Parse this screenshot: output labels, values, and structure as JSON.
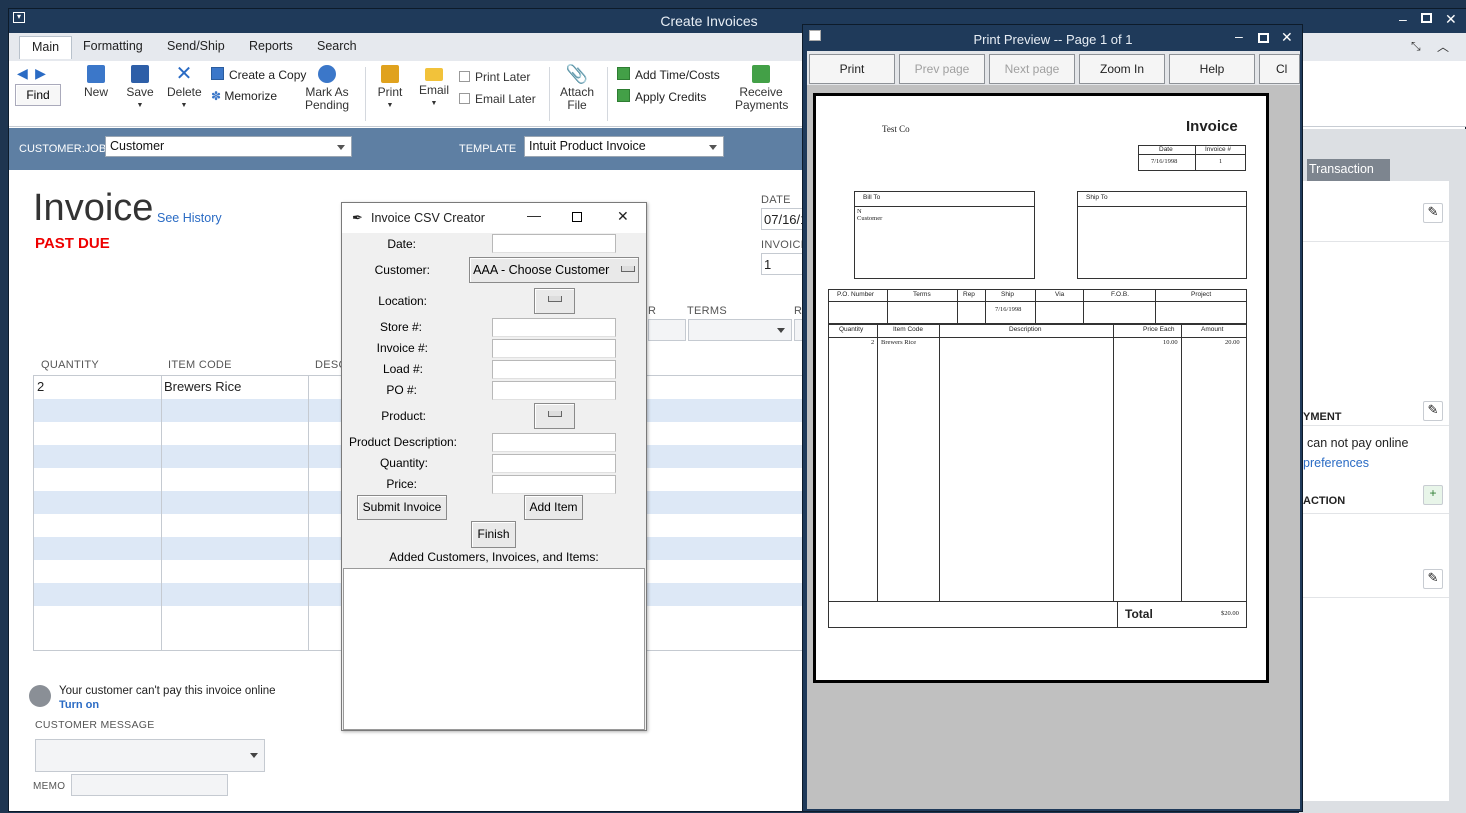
{
  "window": {
    "title": "Create Invoices"
  },
  "tabs": [
    "Main",
    "Formatting",
    "Send/Ship",
    "Reports",
    "Search"
  ],
  "toolbar": {
    "find": "Find",
    "new": "New",
    "save": "Save",
    "delete": "Delete",
    "create_copy": "Create a Copy",
    "memorize": "Memorize",
    "mark_pending_1": "Mark As",
    "mark_pending_2": "Pending",
    "print": "Print",
    "email": "Email",
    "print_later": "Print Later",
    "email_later": "Email Later",
    "attach_1": "Attach",
    "attach_2": "File",
    "add_time": "Add Time/Costs",
    "apply_credits": "Apply Credits",
    "receive_1": "Receive",
    "receive_2": "Payments"
  },
  "header": {
    "customer_label": "CUSTOMER:JOB",
    "customer_value": "Customer",
    "template_label": "TEMPLATE",
    "template_value": "Intuit Product Invoice"
  },
  "invoice": {
    "title": "Invoice",
    "see_history": "See History",
    "past_due": "PAST DUE",
    "date_label": "DATE",
    "date_value": "07/16/1",
    "invoice_label": "INVOICE",
    "invoice_value": "1",
    "terms_label": "TERMS",
    "p_label": "R",
    "r_label": "R"
  },
  "grid": {
    "col_quantity": "QUANTITY",
    "col_item": "ITEM CODE",
    "col_desc": "DESC",
    "rows": [
      {
        "qty": "2",
        "item": "Brewers Rice"
      }
    ]
  },
  "footer": {
    "online_msg": "Your customer can't pay this invoice online",
    "turn_on": "Turn on",
    "customer_message": "CUSTOMER MESSAGE",
    "memo": "MEMO"
  },
  "rightpanel": {
    "tab": "Transaction",
    "payment_hdr": "YMENT",
    "cannot_pay": "can not pay online",
    "preferences": "preferences",
    "action_hdr": "ACTION"
  },
  "csv": {
    "title": "Invoice CSV Creator",
    "date": "Date:",
    "customer": "Customer:",
    "customer_value": "AAA - Choose Customer",
    "location": "Location:",
    "store": "Store #:",
    "invoice": "Invoice #:",
    "load": "Load #:",
    "po": "PO #:",
    "product": "Product:",
    "product_desc": "Product Description:",
    "quantity": "Quantity:",
    "price": "Price:",
    "submit": "Submit Invoice",
    "add_item": "Add Item",
    "finish": "Finish",
    "added": "Added Customers, Invoices, and Items:"
  },
  "preview": {
    "title": "Print Preview -- Page 1 of 1",
    "buttons": {
      "print": "Print",
      "prev": "Prev page",
      "next": "Next page",
      "zoom": "Zoom In",
      "help": "Help",
      "close": "Cl"
    },
    "paper": {
      "company": "Test Co",
      "heading": "Invoice",
      "date_hdr": "Date",
      "invno_hdr": "Invoice #",
      "date": "7/16/1998",
      "invno": "1",
      "bill_to": "Bill To",
      "bill_line1": "N",
      "bill_line2": "Customer",
      "ship_to": "Ship To",
      "po_hdr": "P.O. Number",
      "terms_hdr": "Terms",
      "rep_hdr": "Rep",
      "ship_hdr": "Ship",
      "via_hdr": "Via",
      "fob_hdr": "F.O.B.",
      "project_hdr": "Project",
      "ship_date": "7/16/1998",
      "qty_hdr": "Quantity",
      "item_hdr": "Item Code",
      "desc_hdr": "Description",
      "price_hdr": "Price Each",
      "amount_hdr": "Amount",
      "qty": "2",
      "item": "Brewers Rice",
      "price": "10.00",
      "amount": "20.00",
      "total_lbl": "Total",
      "total": "$20.00"
    }
  }
}
